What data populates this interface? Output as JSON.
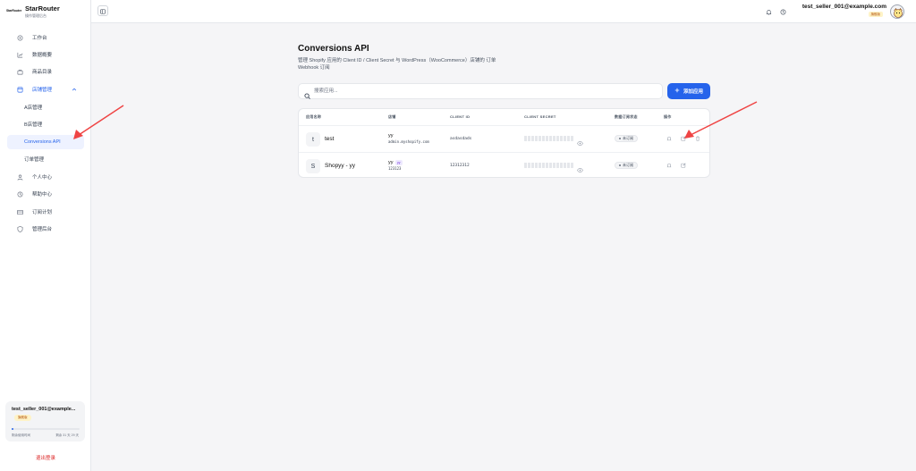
{
  "brand": {
    "logo_text": "StarRouter",
    "name": "StarRouter",
    "subtitle": "操作管理后台"
  },
  "sidebar": {
    "items": [
      {
        "label": "工作台",
        "icon": "home-icon"
      },
      {
        "label": "数据概要",
        "icon": "chart-icon"
      },
      {
        "label": "商品目录",
        "icon": "bag-icon"
      },
      {
        "label": "店铺管理",
        "icon": "store-icon"
      },
      {
        "label": "A店管理"
      },
      {
        "label": "B店管理"
      },
      {
        "label": "Conversions API"
      },
      {
        "label": "订单管理"
      },
      {
        "label": "个人中心",
        "icon": "user-icon"
      },
      {
        "label": "帮助中心",
        "icon": "help-icon"
      },
      {
        "label": "订阅计划",
        "icon": "card-icon"
      },
      {
        "label": "管理后台",
        "icon": "shield-icon"
      }
    ],
    "active": "Conversions API"
  },
  "user_card": {
    "email": "test_seller_001@example...",
    "badge": "旗舰版",
    "left_label": "剩余使用时间",
    "right_label": "剩余 31 天 29 天",
    "progress": 0.02
  },
  "logout_label": "退出登录",
  "topbar": {
    "email": "test_seller_001@example.com",
    "badge": "旗舰版"
  },
  "page": {
    "title": "Conversions API",
    "description": "管理 Shopify 应用的 Client ID / Client Secret 与 WordPress（WooCommerce）店铺的 订单 Webhook 订阅"
  },
  "search": {
    "placeholder": "搜索应用...",
    "value": ""
  },
  "add_button": {
    "label": "添加应用"
  },
  "table": {
    "headers": [
      "应用名称",
      "店铺",
      "CLIENT ID",
      "CLIENT SECRET",
      "数据订阅状态",
      "操作"
    ],
    "rows": [
      {
        "avatar": "t",
        "name": "test",
        "store": "yy",
        "store_tag": "",
        "store_sub": "admin.myshopify.com",
        "client_id": "asdasdads",
        "status": "未订阅"
      },
      {
        "avatar": "S",
        "name": "Shopyy - yy",
        "store": "yy",
        "store_tag": "yy",
        "store_sub": "123123",
        "client_id": "12312312",
        "status": "未订阅"
      }
    ]
  },
  "colors": {
    "accent": "#2563eb",
    "annotation_arrow": "#ef4444",
    "danger": "#dc2626"
  }
}
